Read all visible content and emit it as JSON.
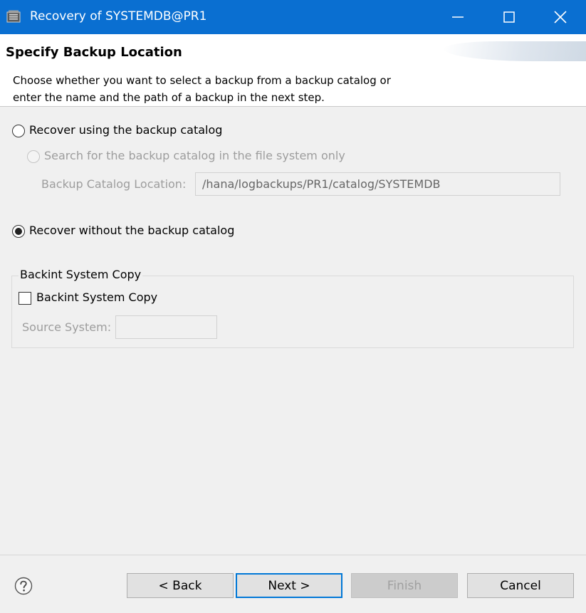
{
  "window": {
    "title": "Recovery of SYSTEMDB@PR1",
    "controls": [
      "minimize-icon",
      "maximize-icon",
      "close-icon"
    ]
  },
  "header": {
    "title": "Specify Backup Location",
    "description_line1": "Choose whether you want to select a backup from a backup catalog or",
    "description_line2": "enter the name and the path of a backup in the next step."
  },
  "options": {
    "with_catalog": {
      "label": "Recover using the backup catalog",
      "selected": false
    },
    "search_fs": {
      "label": "Search for the backup catalog in the file system only",
      "enabled": false
    },
    "catalog_location": {
      "label": "Backup Catalog Location:",
      "value": "/hana/logbackups/PR1/catalog/SYSTEMDB",
      "enabled": false
    },
    "without_catalog": {
      "label": "Recover without the backup catalog",
      "selected": true
    }
  },
  "backint": {
    "group_title": "Backint System Copy",
    "checkbox_label": "Backint System Copy",
    "checked": false,
    "source_system_label": "Source System:",
    "source_system_value": ""
  },
  "footer": {
    "help_icon": "question-circle-icon",
    "back_label": "< Back",
    "next_label": "Next >",
    "finish_label": "Finish",
    "cancel_label": "Cancel"
  },
  "colors": {
    "titlebar": "#0a6fd1",
    "default_button_border": "#0078d7",
    "dialog_background": "#f0f0f0"
  }
}
